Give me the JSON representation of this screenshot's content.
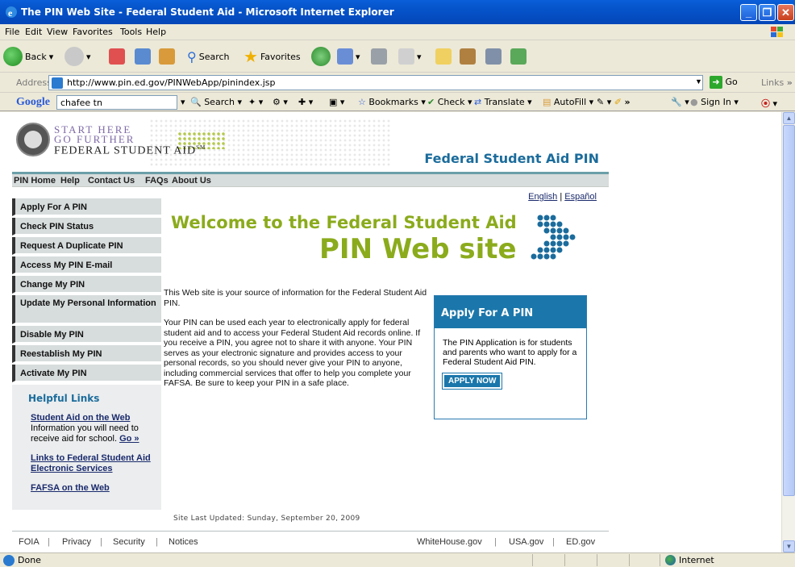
{
  "window": {
    "title": "The PIN Web Site - Federal Student Aid - Microsoft Internet Explorer"
  },
  "menu": [
    "File",
    "Edit",
    "View",
    "Favorites",
    "Tools",
    "Help"
  ],
  "toolbar": {
    "back": "Back",
    "search": "Search",
    "favorites": "Favorites"
  },
  "address": {
    "label": "Address",
    "url": "http://www.pin.ed.gov/PINWebApp/pinindex.jsp",
    "go": "Go",
    "links": "Links"
  },
  "google": {
    "logo": "Google",
    "query": "chafee tn",
    "search": "Search",
    "bookmarks": "Bookmarks",
    "check": "Check",
    "translate": "Translate",
    "autofill": "AutoFill",
    "sign_in": "Sign In"
  },
  "site": {
    "logo_line1": "START HERE",
    "logo_line2": "GO FURTHER",
    "logo_line3": "FEDERAL STUDENT AID",
    "logo_tm": "SM",
    "title": "Federal Student Aid PIN",
    "topnav": [
      "PIN Home",
      "Help",
      "Contact Us",
      "FAQs",
      "About Us"
    ],
    "sidebar": [
      "Apply For A PIN",
      "Check PIN Status",
      "Request A Duplicate PIN",
      "Access My PIN E-mail",
      "Change My PIN",
      "Update My Personal Information",
      "Disable My PIN",
      "Reestablish My PIN",
      "Activate My PIN"
    ],
    "helpful": {
      "heading": "Helpful Links",
      "link1": "Student Aid on the Web",
      "link1_desc": "Information you will need to receive aid for school.",
      "link1_go": "Go »",
      "link2": "Links to Federal Student Aid Electronic Services",
      "link3": "FAFSA on the Web"
    },
    "lang_en": "English",
    "lang_sep": "|",
    "lang_es": "Español",
    "welcome_line1": "Welcome to the Federal Student Aid",
    "welcome_line2": "PIN Web site",
    "para1": "This Web site is your source of information for the Federal Student Aid PIN.",
    "para2": "Your PIN can be used each year to electronically apply for federal student aid and to access your Federal Student Aid records online. If you receive a PIN, you agree not to share it with anyone. Your PIN serves as your electronic signature and provides access to your personal records, so you should never give your PIN to anyone, including commercial services that offer to help you complete your FAFSA. Be sure to keep your PIN in a safe place.",
    "apply_box": {
      "heading": "Apply For A PIN",
      "text": "The PIN Application is for students and parents who want to apply for a Federal Student Aid PIN.",
      "button": "APPLY NOW"
    },
    "updated": "Site Last Updated: Sunday, September 20, 2009",
    "footer_left": [
      "FOIA",
      "Privacy",
      "Security",
      "Notices"
    ],
    "footer_right": [
      "WhiteHouse.gov",
      "USA.gov",
      "ED.gov"
    ]
  },
  "status": {
    "text": "Done",
    "zone": "Internet"
  },
  "colors": {
    "accent_blue": "#1b77ab",
    "accent_green": "#8bab1c",
    "title_blue": "#1b6c9c"
  }
}
